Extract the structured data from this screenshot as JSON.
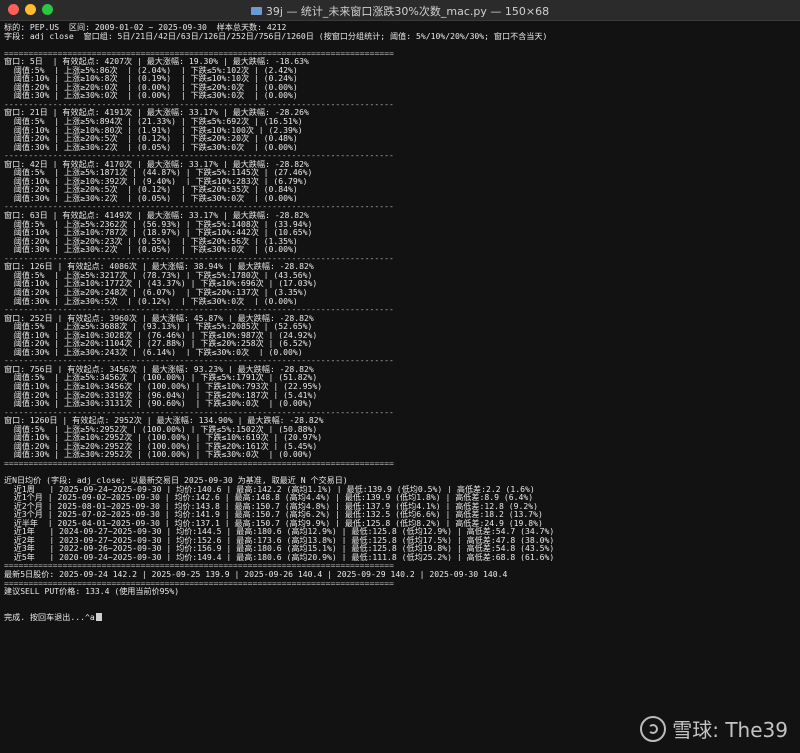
{
  "window": {
    "title": "39j — 统计_未来窗口涨跌30%次数_mac.py — 150×68"
  },
  "terminal": {
    "lines": [
      "标的: PEP.US  区间: 2009-01-02 ~ 2025-09-30  样本总天数: 4212",
      "字段: adj_close  窗口组: 5日/21日/42日/63日/126日/252日/756日/1260日 (按窗口分组统计; 阈值: 5%/10%/20%/30%; 窗口不含当天)",
      "",
      "================================================================================",
      "窗口: 5日  | 有效起点: 4207次 | 最大涨幅: 19.30% | 最大跌幅: -18.63%",
      "  阈值:5%  | 上涨≥5%:86次  | (2.04%)  | 下跌≤5%:102次 | (2.42%)",
      "  阈值:10% | 上涨≥10%:8次  | (0.19%)  | 下跌≤10%:10次 | (0.24%)",
      "  阈值:20% | 上涨≥20%:0次  | (0.00%)  | 下跌≤20%:0次  | (0.00%)",
      "  阈值:30% | 上涨≥30%:0次  | (0.00%)  | 下跌≤30%:0次  | (0.00%)",
      "--------------------------------------------------------------------------------",
      "窗口: 21日 | 有效起点: 4191次 | 最大涨幅: 33.17% | 最大跌幅: -28.26%",
      "  阈值:5%  | 上涨≥5%:894次 | (21.33%) | 下跌≤5%:692次 | (16.51%)",
      "  阈值:10% | 上涨≥10%:80次 | (1.91%)  | 下跌≤10%:100次 | (2.39%)",
      "  阈值:20% | 上涨≥20%:5次  | (0.12%)  | 下跌≤20%:20次 | (0.48%)",
      "  阈值:30% | 上涨≥30%:2次  | (0.05%)  | 下跌≤30%:0次  | (0.00%)",
      "--------------------------------------------------------------------------------",
      "窗口: 42日 | 有效起点: 4170次 | 最大涨幅: 33.17% | 最大跌幅: -28.82%",
      "  阈值:5%  | 上涨≥5%:1871次 | (44.87%) | 下跌≤5%:1145次 | (27.46%)",
      "  阈值:10% | 上涨≥10%:392次 | (9.40%)  | 下跌≤10%:283次 | (6.79%)",
      "  阈值:20% | 上涨≥20%:5次  | (0.12%)  | 下跌≤20%:35次 | (0.84%)",
      "  阈值:30% | 上涨≥30%:2次  | (0.05%)  | 下跌≤30%:0次  | (0.00%)",
      "--------------------------------------------------------------------------------",
      "窗口: 63日 | 有效起点: 4149次 | 最大涨幅: 33.17% | 最大跌幅: -28.82%",
      "  阈值:5%  | 上涨≥5%:2362次 | (56.93%) | 下跌≤5%:1408次 | (33.94%)",
      "  阈值:10% | 上涨≥10%:787次 | (18.97%) | 下跌≤10%:442次 | (10.65%)",
      "  阈值:20% | 上涨≥20%:23次 | (0.55%)  | 下跌≤20%:56次 | (1.35%)",
      "  阈值:30% | 上涨≥30%:2次  | (0.05%)  | 下跌≤30%:0次  | (0.00%)",
      "--------------------------------------------------------------------------------",
      "窗口: 126日 | 有效起点: 4086次 | 最大涨幅: 38.94% | 最大跌幅: -28.82%",
      "  阈值:5%  | 上涨≥5%:3217次 | (78.73%) | 下跌≤5%:1780次 | (43.56%)",
      "  阈值:10% | 上涨≥10%:1772次 | (43.37%) | 下跌≤10%:696次 | (17.03%)",
      "  阈值:20% | 上涨≥20%:248次 | (6.07%)  | 下跌≤20%:137次 | (3.35%)",
      "  阈值:30% | 上涨≥30%:5次  | (0.12%)  | 下跌≤30%:0次  | (0.00%)",
      "--------------------------------------------------------------------------------",
      "窗口: 252日 | 有效起点: 3960次 | 最大涨幅: 45.87% | 最大跌幅: -28.82%",
      "  阈值:5%  | 上涨≥5%:3688次 | (93.13%) | 下跌≤5%:2085次 | (52.65%)",
      "  阈值:10% | 上涨≥10%:3028次 | (76.46%) | 下跌≤10%:987次 | (24.92%)",
      "  阈值:20% | 上涨≥20%:1104次 | (27.88%) | 下跌≤20%:258次 | (6.52%)",
      "  阈值:30% | 上涨≥30%:243次 | (6.14%)  | 下跌≤30%:0次  | (0.00%)",
      "--------------------------------------------------------------------------------",
      "窗口: 756日 | 有效起点: 3456次 | 最大涨幅: 93.23% | 最大跌幅: -28.82%",
      "  阈值:5%  | 上涨≥5%:3456次 | (100.00%) | 下跌≤5%:1791次 | (51.82%)",
      "  阈值:10% | 上涨≥10%:3456次 | (100.00%) | 下跌≤10%:793次 | (22.95%)",
      "  阈值:20% | 上涨≥20%:3319次 | (96.04%)  | 下跌≤20%:187次 | (5.41%)",
      "  阈值:30% | 上涨≥30%:3131次 | (90.60%)  | 下跌≤30%:0次  | (0.00%)",
      "--------------------------------------------------------------------------------",
      "窗口: 1260日 | 有效起点: 2952次 | 最大涨幅: 134.90% | 最大跌幅: -28.82%",
      "  阈值:5%  | 上涨≥5%:2952次 | (100.00%) | 下跌≤5%:1502次 | (50.88%)",
      "  阈值:10% | 上涨≥10%:2952次 | (100.00%) | 下跌≤10%:619次 | (20.97%)",
      "  阈值:20% | 上涨≥20%:2952次 | (100.00%) | 下跌≤20%:161次 | (5.45%)",
      "  阈值:30% | 上涨≥30%:2952次 | (100.00%) | 下跌≤30%:0次  | (0.00%)",
      "================================================================================",
      "",
      "近N日均价 (字段: adj_close; 以最新交易日 2025-09-30 为基准, 取最近 N 个交易日)",
      "  近1周   | 2025-09-24~2025-09-30 | 均价:140.6 | 最高:142.2 (高均1.1%) | 最低:139.9 (低均0.5%) | 高低差:2.2 (1.6%)",
      "  近1个月 | 2025-09-02~2025-09-30 | 均价:142.6 | 最高:148.8 (高均4.4%) | 最低:139.9 (低均1.8%) | 高低差:8.9 (6.4%)",
      "  近2个月 | 2025-08-01~2025-09-30 | 均价:143.8 | 最高:150.7 (高均4.8%) | 最低:137.9 (低均4.1%) | 高低差:12.8 (9.2%)",
      "  近3个月 | 2025-07-02~2025-09-30 | 均价:141.9 | 最高:150.7 (高均6.2%) | 最低:132.5 (低均6.6%) | 高低差:18.2 (13.7%)",
      "  近半年  | 2025-04-01~2025-09-30 | 均价:137.1 | 最高:150.7 (高均9.9%) | 最低:125.8 (低均8.2%) | 高低差:24.9 (19.8%)",
      "  近1年   | 2024-09-27~2025-09-30 | 均价:144.5 | 最高:180.6 (高均12.9%) | 最低:125.8 (低均12.9%) | 高低差:54.7 (34.7%)",
      "  近2年   | 2023-09-27~2025-09-30 | 均价:152.6 | 最高:173.6 (高均13.8%) | 最低:125.8 (低均17.5%) | 高低差:47.8 (38.0%)",
      "  近3年   | 2022-09-26~2025-09-30 | 均价:156.9 | 最高:180.6 (高均15.1%) | 最低:125.8 (低均19.8%) | 高低差:54.8 (43.5%)",
      "  近5年   | 2020-09-24~2025-09-30 | 均价:149.4 | 最高:180.6 (高均20.9%) | 最低:111.8 (低均25.2%) | 高低差:68.8 (61.6%)",
      "================================================================================",
      "最新5日股价: 2025-09-24 142.2 | 2025-09-25 139.9 | 2025-09-26 140.4 | 2025-09-29 140.2 | 2025-09-30 140.4",
      "================================================================================",
      "建议SELL PUT价格: 133.4 (使用当前价95%)",
      "",
      "",
      "完成. 按回车退出...^a"
    ]
  },
  "watermark": {
    "text": "雪球: The39"
  }
}
